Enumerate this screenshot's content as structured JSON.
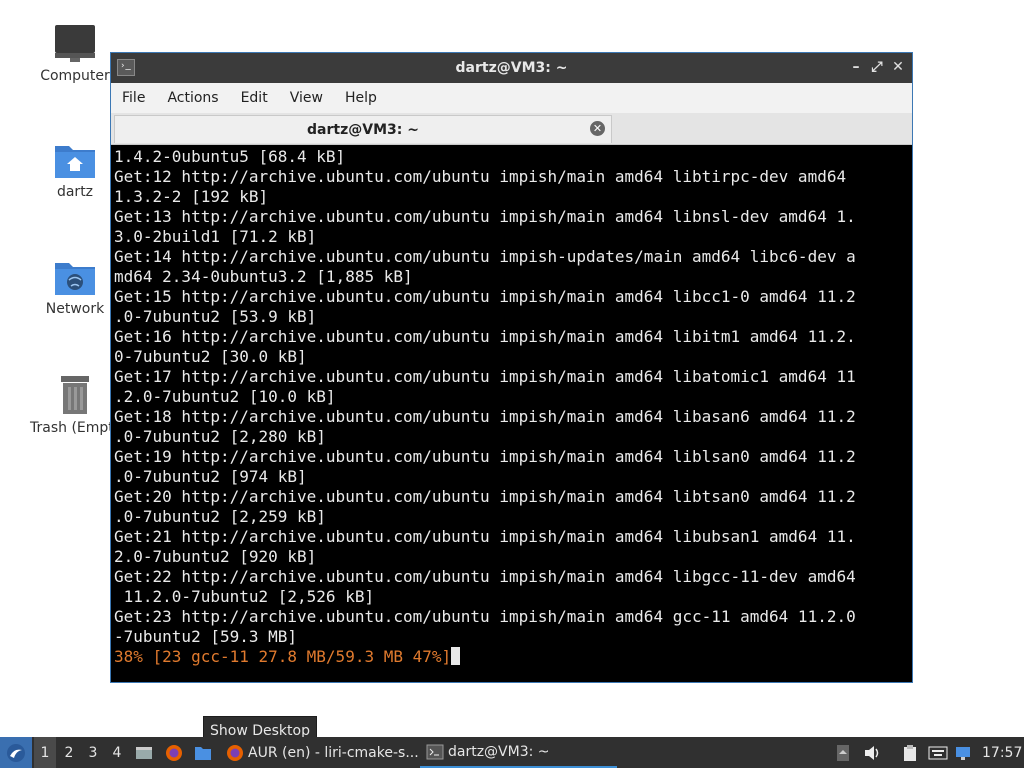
{
  "desktop": {
    "icons": [
      {
        "label": "Computer",
        "icon": "computer-icon"
      },
      {
        "label": "dartz",
        "icon": "home-folder-icon"
      },
      {
        "label": "Network",
        "icon": "network-folder-icon"
      },
      {
        "label": "Trash (Empty)",
        "icon": "trash-icon"
      }
    ]
  },
  "window": {
    "title": "dartz@VM3: ~",
    "menu": [
      "File",
      "Actions",
      "Edit",
      "View",
      "Help"
    ],
    "tab_label": "dartz@VM3: ~",
    "terminal_lines": [
      "1.4.2-0ubuntu5 [68.4 kB]",
      "Get:12 http://archive.ubuntu.com/ubuntu impish/main amd64 libtirpc-dev amd64",
      "1.3.2-2 [192 kB]",
      "Get:13 http://archive.ubuntu.com/ubuntu impish/main amd64 libnsl-dev amd64 1.",
      "3.0-2build1 [71.2 kB]",
      "Get:14 http://archive.ubuntu.com/ubuntu impish-updates/main amd64 libc6-dev a",
      "md64 2.34-0ubuntu3.2 [1,885 kB]",
      "Get:15 http://archive.ubuntu.com/ubuntu impish/main amd64 libcc1-0 amd64 11.2",
      ".0-7ubuntu2 [53.9 kB]",
      "Get:16 http://archive.ubuntu.com/ubuntu impish/main amd64 libitm1 amd64 11.2.",
      "0-7ubuntu2 [30.0 kB]",
      "Get:17 http://archive.ubuntu.com/ubuntu impish/main amd64 libatomic1 amd64 11",
      ".2.0-7ubuntu2 [10.0 kB]",
      "Get:18 http://archive.ubuntu.com/ubuntu impish/main amd64 libasan6 amd64 11.2",
      ".0-7ubuntu2 [2,280 kB]",
      "Get:19 http://archive.ubuntu.com/ubuntu impish/main amd64 liblsan0 amd64 11.2",
      ".0-7ubuntu2 [974 kB]",
      "Get:20 http://archive.ubuntu.com/ubuntu impish/main amd64 libtsan0 amd64 11.2",
      ".0-7ubuntu2 [2,259 kB]",
      "Get:21 http://archive.ubuntu.com/ubuntu impish/main amd64 libubsan1 amd64 11.",
      "2.0-7ubuntu2 [920 kB]",
      "Get:22 http://archive.ubuntu.com/ubuntu impish/main amd64 libgcc-11-dev amd64",
      " 11.2.0-7ubuntu2 [2,526 kB]",
      "Get:23 http://archive.ubuntu.com/ubuntu impish/main amd64 gcc-11 amd64 11.2.0",
      "-7ubuntu2 [59.3 MB]"
    ],
    "progress_line": "38% [23 gcc-11 27.8 MB/59.3 MB 47%]",
    "progress_color": "#e07a2e"
  },
  "tooltip": "Show Desktop",
  "taskbar": {
    "workspaces": [
      "1",
      "2",
      "3",
      "4"
    ],
    "active_workspace": "1",
    "tasks": [
      {
        "label": "AUR (en) - liri-cmake-s...",
        "icon": "firefox-icon"
      },
      {
        "label": "dartz@VM3: ~",
        "icon": "terminal-icon"
      }
    ],
    "clock": "17:57"
  }
}
